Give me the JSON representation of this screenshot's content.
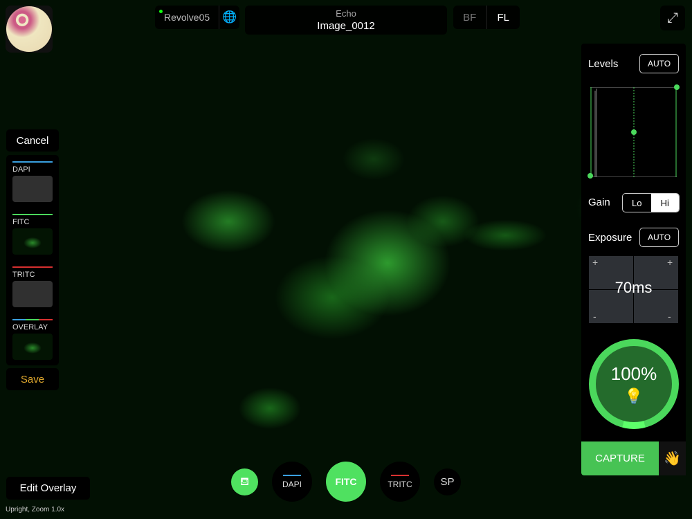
{
  "header": {
    "device_name": "Revolve05",
    "app_name": "Echo",
    "image_name": "Image_0012",
    "modes": [
      "BF",
      "FL"
    ],
    "active_mode": "FL"
  },
  "left": {
    "cancel": "Cancel",
    "save": "Save",
    "edit_overlay": "Edit Overlay",
    "channels": [
      {
        "label": "DAPI",
        "color": "#3aa0e0"
      },
      {
        "label": "FITC",
        "color": "#4bd85c"
      },
      {
        "label": "TRITC",
        "color": "#d83030"
      },
      {
        "label": "OVERLAY",
        "color": "multi"
      }
    ]
  },
  "status": "Upright, Zoom 1.0x",
  "bottom": {
    "buttons": [
      "DAPI",
      "FITC",
      "TRITC",
      "SP"
    ],
    "active": "FITC"
  },
  "panel": {
    "levels": "Levels",
    "levels_auto": "AUTO",
    "gain": "Gain",
    "gain_options": [
      "Lo",
      "Hi"
    ],
    "gain_selected": "Hi",
    "exposure": "Exposure",
    "exposure_auto": "AUTO",
    "exposure_value": "70ms",
    "plus": "+",
    "minus": "-",
    "intensity": "100%",
    "capture": "CAPTURE"
  },
  "colors": {
    "accent": "#4bd85c",
    "save": "#e0a82e"
  }
}
